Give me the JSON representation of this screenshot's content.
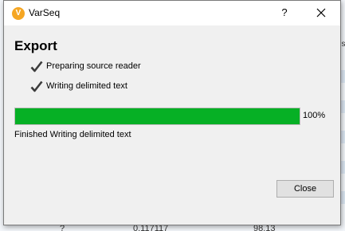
{
  "window": {
    "title": "VarSeq",
    "app_icon_letter": "V",
    "help_label": "?"
  },
  "export": {
    "heading": "Export",
    "steps": [
      {
        "label": "Preparing source reader",
        "icon": "checkmark-icon"
      },
      {
        "label": "Writing delimited text",
        "icon": "checkmark-icon"
      }
    ],
    "progress_percent": 100,
    "progress_label": "100%",
    "status": "Finished Writing delimited text"
  },
  "buttons": {
    "close_label": "Close"
  },
  "background": {
    "bottom_row": {
      "col1": "?",
      "col2": "0.117117",
      "col3": "98.13"
    },
    "side_text": "ns"
  },
  "colors": {
    "progress_fill": "#06b025",
    "app_icon": "#f5a623"
  }
}
